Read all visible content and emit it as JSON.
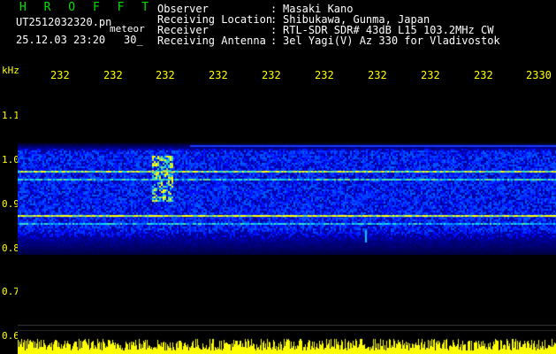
{
  "header": {
    "brand": "H R O F F T",
    "filename": "UT2512032320.pn",
    "mode": "meteor",
    "datetime": "25.12.03 23:20",
    "seconds": "30_",
    "fields": [
      {
        "key": "Observer",
        "value": "Masaki Kano"
      },
      {
        "key": "Receiving Location",
        "value": "Shibukawa, Gunma, Japan"
      },
      {
        "key": "Receiver",
        "value": "RTL-SDR SDR# 43dB L15 103.2MHz CW"
      },
      {
        "key": "Receiving Antenna",
        "value": "3el Yagi(V) Az 330 for Vladivostok"
      }
    ]
  },
  "axes": {
    "y_unit": "kHz",
    "x_ticks": [
      "232",
      "232",
      "232",
      "232",
      "232",
      "232",
      "232",
      "232",
      "232",
      "2330"
    ],
    "y_ticks": [
      "1.1",
      "1.0",
      "0.9",
      "0.8",
      "0.7",
      "0.6"
    ]
  },
  "colors": {
    "background": "#000000",
    "label": "#ffff00",
    "brand": "#00e000",
    "spectrum_low": "#00008b",
    "spectrum_mid": "#00c8ff",
    "spectrum_high": "#ffff00"
  }
}
